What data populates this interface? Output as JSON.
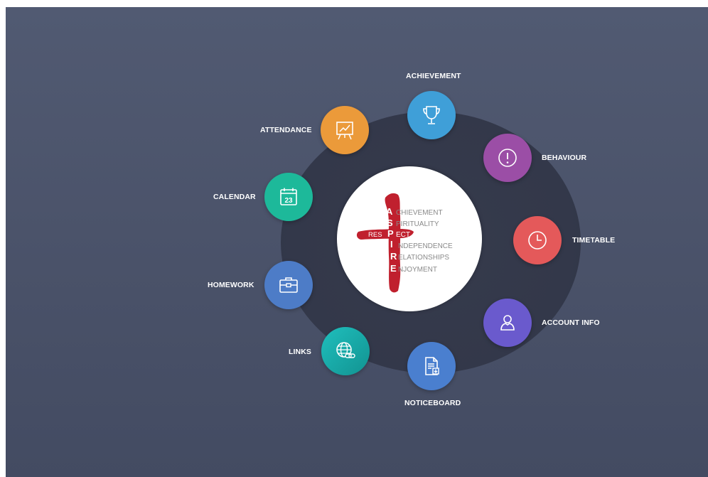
{
  "nav": {
    "achievement": {
      "label": "ACHIEVEMENT",
      "icon": "trophy-icon",
      "color": "#3f9fd8"
    },
    "behaviour": {
      "label": "BEHAVIOUR",
      "icon": "exclamation-icon",
      "color": "#9b4ea6"
    },
    "timetable": {
      "label": "TIMETABLE",
      "icon": "clock-icon",
      "color": "#e4595a"
    },
    "account_info": {
      "label": "ACCOUNT INFO",
      "icon": "user-icon",
      "color": "#6a5acd"
    },
    "noticeboard": {
      "label": "NOTICEBOARD",
      "icon": "document-icon",
      "color": "#4a7fcf"
    },
    "links": {
      "label": "LINKS",
      "icon": "globe-link-icon",
      "color": "#17a8a6"
    },
    "homework": {
      "label": "HOMEWORK",
      "icon": "briefcase-icon",
      "color": "#4d7cc7"
    },
    "calendar": {
      "label": "CALENDAR",
      "icon": "calendar-icon",
      "color": "#1db99a",
      "day": "23"
    },
    "attendance": {
      "label": "ATTENDANCE",
      "icon": "presentation-chart-icon",
      "color": "#eb9a3a"
    }
  },
  "logo": {
    "letters": [
      "A",
      "S",
      "P",
      "I",
      "R",
      "E"
    ],
    "words": [
      "CHIEVEMENT",
      "PIRITUALITY",
      "ECT",
      "NDEPENDENCE",
      "ELATIONSHIPS",
      "NJOYMENT"
    ],
    "cross_word_left": "RES",
    "cross_color": "#c0202e"
  }
}
